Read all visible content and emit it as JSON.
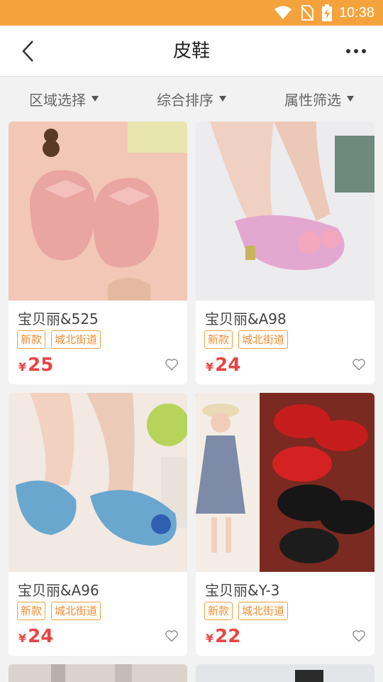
{
  "status_bar": {
    "time": "10:38"
  },
  "nav": {
    "title": "皮鞋"
  },
  "filters": [
    {
      "label": "区域选择"
    },
    {
      "label": "综合排序"
    },
    {
      "label": "属性筛选"
    }
  ],
  "products": [
    {
      "name": "宝贝丽&525",
      "tags": [
        "新款",
        "城北街道"
      ],
      "currency": "¥",
      "price": "25"
    },
    {
      "name": "宝贝丽&A98",
      "tags": [
        "新款",
        "城北街道"
      ],
      "currency": "¥",
      "price": "24"
    },
    {
      "name": "宝贝丽&A96",
      "tags": [
        "新款",
        "城北街道"
      ],
      "currency": "¥",
      "price": "24"
    },
    {
      "name": "宝贝丽&Y-3",
      "tags": [
        "新款",
        "城北街道"
      ],
      "currency": "¥",
      "price": "22"
    }
  ],
  "colors": {
    "accent": "#f4a33c",
    "price": "#e84545",
    "tag": "#f08c30"
  }
}
